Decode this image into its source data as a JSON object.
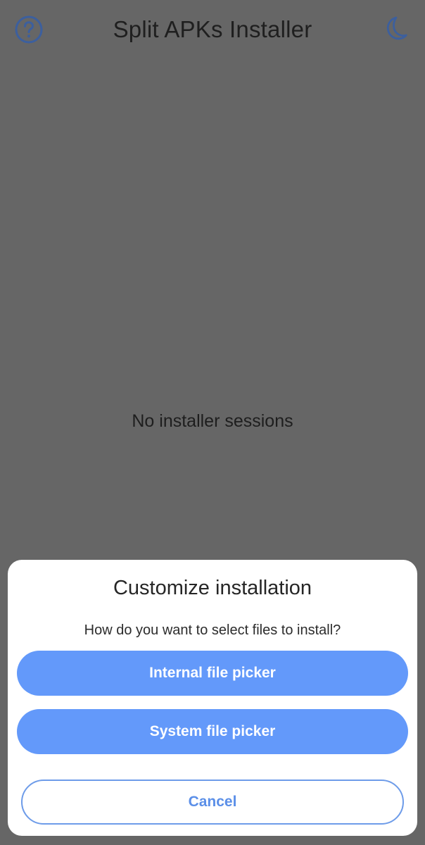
{
  "app_bar": {
    "title": "Split APKs Installer",
    "left_icon": "help-circle-icon",
    "right_icon": "moon-icon",
    "icon_color": "#3c5f9e"
  },
  "main": {
    "empty_message": "No installer sessions"
  },
  "dialog": {
    "title": "Customize installation",
    "subtitle": "How do you want to select files to install?",
    "internal_picker_label": "Internal file picker",
    "system_picker_label": "System file picker",
    "cancel_label": "Cancel",
    "primary_color": "#6399fa"
  }
}
